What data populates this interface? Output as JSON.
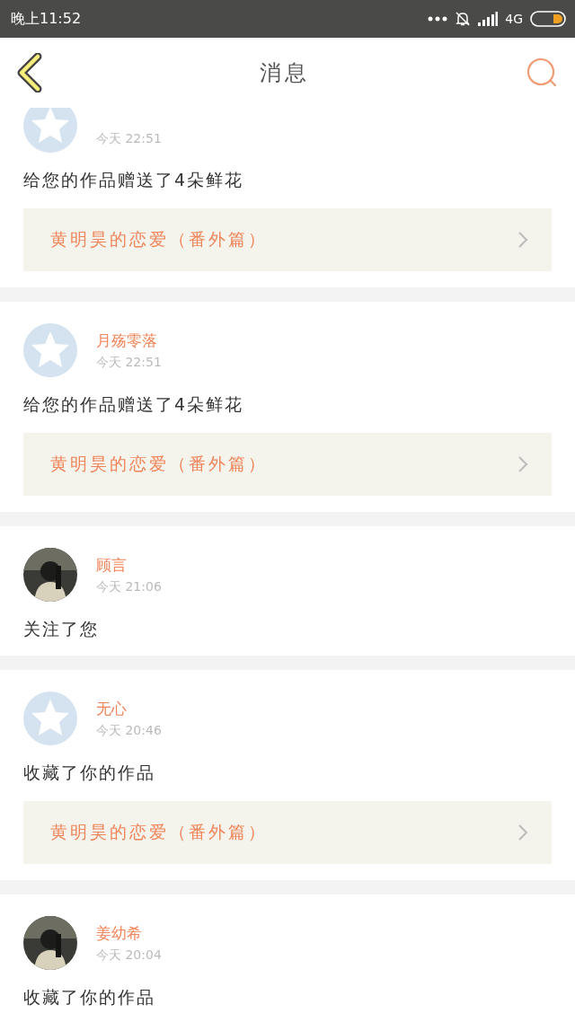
{
  "status_bar": {
    "time": "晚上11:52",
    "network": "4G"
  },
  "header": {
    "title": "消息"
  },
  "messages": [
    {
      "avatar": {
        "kind": "default"
      },
      "time": "今天 22:51",
      "text": "给您的作品赠送了4朵鲜花",
      "work": "黄明昊的恋爱（番外篇）"
    },
    {
      "avatar": {
        "kind": "default"
      },
      "name": "月殇零落",
      "time": "今天 22:51",
      "text": "给您的作品赠送了4朵鲜花",
      "work": "黄明昊的恋爱（番外篇）"
    },
    {
      "name": "顾言",
      "time": "今天 21:06",
      "text": "关注了您"
    },
    {
      "avatar": {
        "kind": "default"
      },
      "name": "无心",
      "time": "今天 20:46",
      "text": "收藏了你的作品",
      "work": "黄明昊的恋爱（番外篇）"
    },
    {
      "name": "姜幼希",
      "time": "今天 20:04",
      "text": "收藏了你的作品"
    }
  ]
}
